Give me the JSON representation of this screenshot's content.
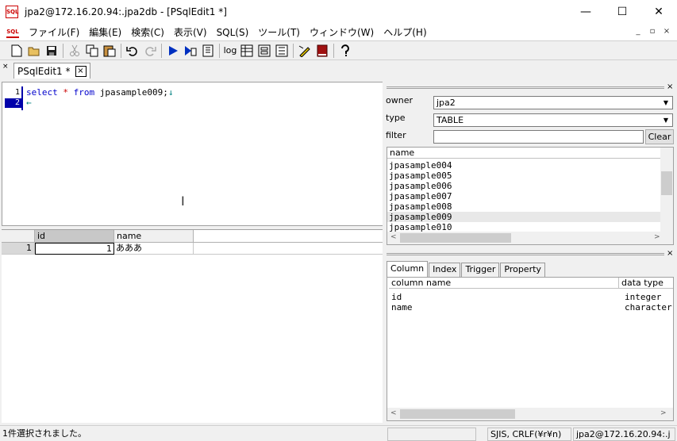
{
  "window": {
    "title": "jpa2@172.16.20.94:.jpa2db - [PSqlEdit1 *]",
    "app_icon_text": "SQL",
    "minimize": "—",
    "maximize": "☐",
    "close": "✕"
  },
  "menu": [
    "ファイル(F)",
    "編集(E)",
    "検索(C)",
    "表示(V)",
    "SQL(S)",
    "ツール(T)",
    "ウィンドウ(W)",
    "ヘルプ(H)"
  ],
  "mdi": {
    "minimize": "_",
    "restore": "▫",
    "close": "×"
  },
  "toolbar": {
    "log_label": "log"
  },
  "tab": {
    "label": "PSqlEdit1 *",
    "close": "×",
    "side_close": "×"
  },
  "editor": {
    "line_numbers": [
      "1",
      "2"
    ],
    "line1": {
      "kw1": "select",
      "op": "*",
      "kw2": "from",
      "ident": "jpasample009;",
      "eol": "↓"
    },
    "line2": {
      "eof": "←"
    }
  },
  "grid": {
    "headers": [
      "id",
      "name"
    ],
    "rows": [
      {
        "rownum": "1",
        "id": "1",
        "name": "あああ"
      }
    ]
  },
  "right_pane": {
    "owner_label": "owner",
    "owner_value": "jpa2",
    "type_label": "type",
    "type_value": "TABLE",
    "filter_label": "filter",
    "filter_value": "",
    "clear_label": "Clear",
    "table_list_header": "name",
    "tables": [
      "jpasample004",
      "jpasample005",
      "jpasample006",
      "jpasample007",
      "jpasample008",
      "jpasample009",
      "jpasample010"
    ],
    "selected_table": "jpasample009",
    "tabs": [
      "Column",
      "Index",
      "Trigger",
      "Property"
    ],
    "active_tab": "Column",
    "columns_header": {
      "name": "column name",
      "type": "data type"
    },
    "columns": [
      {
        "name": "id",
        "type": "integer"
      },
      {
        "name": "name",
        "type": "character"
      }
    ]
  },
  "status": {
    "message": "1件選択されました。",
    "encoding": "SJIS, CRLF(¥r¥n)",
    "connection": "jpa2@172.16.20.94:.j"
  }
}
